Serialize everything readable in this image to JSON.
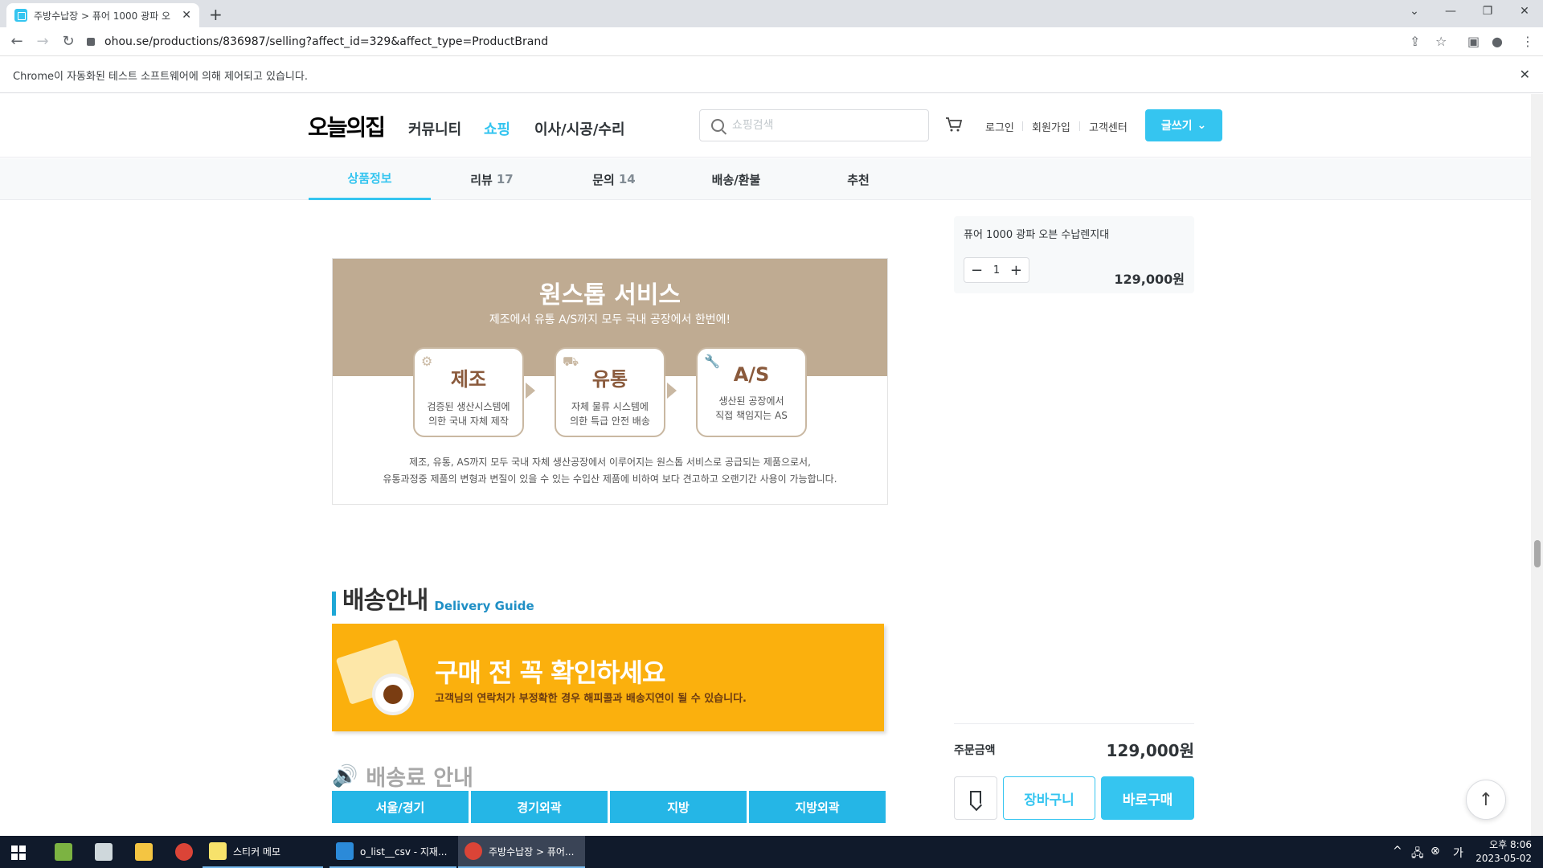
{
  "browser": {
    "tab_title": "주방수납장 > 퓨어 1000 광파 오",
    "url": "ohou.se/productions/836987/selling?affect_id=329&affect_type=ProductBrand",
    "automation_notice": "Chrome이 자동화된 테스트 소프트웨어에 의해 제어되고 있습니다."
  },
  "header": {
    "logo": "오늘의집",
    "nav": [
      "커뮤니티",
      "쇼핑",
      "이사/시공/수리"
    ],
    "search_placeholder": "쇼핑검색",
    "links": [
      "로그인",
      "회원가입",
      "고객센터"
    ],
    "write_button": "글쓰기"
  },
  "product_tabs": [
    {
      "label": "상품정보",
      "count": ""
    },
    {
      "label": "리뷰",
      "count": "17"
    },
    {
      "label": "문의",
      "count": "14"
    },
    {
      "label": "배송/환불",
      "count": ""
    },
    {
      "label": "추천",
      "count": ""
    }
  ],
  "onestop": {
    "title": "원스톱 서비스",
    "subtitle": "제조에서 유통 A/S까지 모두 국내 공장에서 한번에!",
    "services": [
      {
        "title": "제조",
        "line1": "검증된 생산시스템에",
        "line2": "의한 국내 자체 제작"
      },
      {
        "title": "유통",
        "line1": "자체 물류 시스템에",
        "line2": "의한 특급 안전 배송"
      },
      {
        "title": "A/S",
        "line1": "생산된 공장에서",
        "line2": "직접 책임지는 AS"
      }
    ],
    "desc1": "제조, 유통, AS까지 모두 국내 자체 생산공장에서 이루어지는 원스톱 서비스로 공급되는 제품으로서,",
    "desc2": "유통과정중 제품의 변형과 변질이 있을 수 있는 수입산 제품에 비하여 보다 견고하고 오랜기간 사용이 가능합니다."
  },
  "delivery": {
    "heading_ko": "배송안내",
    "heading_en": "Delivery Guide",
    "banner_title": "구매 전 꼭 확인하세요",
    "banner_sub": "고객님의 연락처가 부정확한 경우 해피콜과 배송지연이 될 수 있습니다.",
    "fee_heading": "배송료 안내",
    "fee_columns": [
      "서울/경기",
      "경기외곽",
      "지방",
      "지방외곽"
    ]
  },
  "sidebar": {
    "option_name": "퓨어 1000 광파 오븐 수납렌지대",
    "quantity": "1",
    "option_price": "129,000원",
    "order_label": "주문금액",
    "order_total": "129,000원",
    "cart_button": "장바구니",
    "buy_button": "바로구매"
  },
  "taskbar": {
    "apps": [
      "스티커 메모",
      "o_list__csv - 지재...",
      "주방수납장 > 퓨어..."
    ],
    "time": "오후 8:06",
    "date": "2023-05-02"
  },
  "colors": {
    "accent": "#35c5f0",
    "band": "#bfab92",
    "banner": "#fbb00d",
    "table_header": "#25b6e6"
  }
}
